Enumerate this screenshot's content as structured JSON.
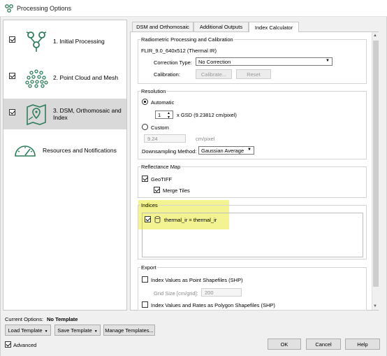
{
  "window": {
    "title": "Processing Options"
  },
  "nav": {
    "items": [
      {
        "label": "1. Initial Processing",
        "checked": true,
        "icon": "initial-processing-icon"
      },
      {
        "label": "2. Point Cloud and Mesh",
        "checked": true,
        "icon": "point-cloud-icon"
      },
      {
        "label": "3. DSM, Orthomosaic and Index",
        "checked": true,
        "icon": "map-pin-icon",
        "active": true
      },
      {
        "label": "Resources and Notifications",
        "icon": "gauge-icon"
      }
    ]
  },
  "tabs": [
    {
      "label": "DSM and Orthomosaic"
    },
    {
      "label": "Additional Outputs"
    },
    {
      "label": "Index Calculator",
      "active": true
    }
  ],
  "radiometric": {
    "title": "Radiometric Processing and Calibration",
    "camera": "FLIR_9.0_640x512 (Thermal IR)",
    "correction_label": "Correction Type:",
    "correction_value": "No Correction",
    "calibration_label": "Calibration:",
    "calibrate_btn": "Calibrate...",
    "reset_btn": "Reset"
  },
  "resolution": {
    "title": "Resolution",
    "automatic_label": "Automatic",
    "gsd_value": "1",
    "gsd_text": "x GSD (9.23812 cm/pixel)",
    "custom_label": "Custom",
    "custom_value": "9.24",
    "custom_unit": "cm/pixel",
    "downsampling_label": "Downsampling Method:",
    "downsampling_value": "Gaussian Average"
  },
  "reflectance": {
    "title": "Reflectance Map",
    "geotiff_label": "GeoTIFF",
    "merge_label": "Merge Tiles"
  },
  "indices": {
    "title": "Indices",
    "items": [
      {
        "label": "thermal_ir = thermal_ir",
        "checked": true
      }
    ]
  },
  "export": {
    "title": "Export",
    "shp_points_label": "Index Values as Point Shapefiles (SHP)",
    "grid_label": "Grid Size [cm/grid]:",
    "grid_value": "200",
    "shp_polygons_label": "Index Values and Rates as Polygon Shapefiles (SHP)"
  },
  "footer": {
    "current_label": "Current Options:",
    "current_value": "No Template",
    "load_template": "Load Template",
    "save_template": "Save Template",
    "manage_templates": "Manage Templates...",
    "advanced_label": "Advanced",
    "ok": "OK",
    "cancel": "Cancel",
    "help": "Help"
  },
  "colors": {
    "highlight": "#f2f28c",
    "icon_green": "#2e7d5b"
  }
}
